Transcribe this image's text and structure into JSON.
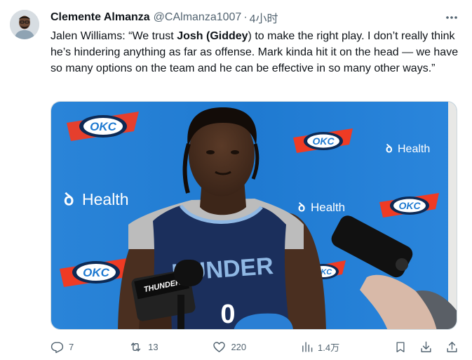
{
  "author": {
    "display_name": "Clemente Almanza",
    "handle": "@CAlmanza1007",
    "separator": "·",
    "time": "4小时"
  },
  "tweet": {
    "part1": "Jalen Williams: “We trust ",
    "bold1": "Josh",
    "part2": " ",
    "bold2": "(Giddey",
    "part3": ") to make the right play. I don’t really think he’s hindering anything as far as offense. Mark kinda hit it on the head — we have so many options on the team and he can be effective in so many other ways.”"
  },
  "media": {
    "backdrop_color": "#1f7ad1",
    "jersey_text": "HUNDER",
    "jersey_number": "0",
    "sponsor_text": "Health",
    "logo_text": "OKC",
    "mic_flag_text": "THUNDER"
  },
  "actions": {
    "reply_count": "7",
    "retweet_count": "13",
    "like_count": "220",
    "views_count": "1.4万"
  },
  "icons": {
    "more": "more-icon",
    "reply": "reply-icon",
    "retweet": "retweet-icon",
    "like": "heart-icon",
    "views": "views-icon",
    "bookmark": "bookmark-icon",
    "share": "share-icon"
  },
  "colors": {
    "text": "#0f1419",
    "muted": "#536471",
    "thunder_blue": "#1f7ad1",
    "okc_orange": "#ef3b24"
  }
}
